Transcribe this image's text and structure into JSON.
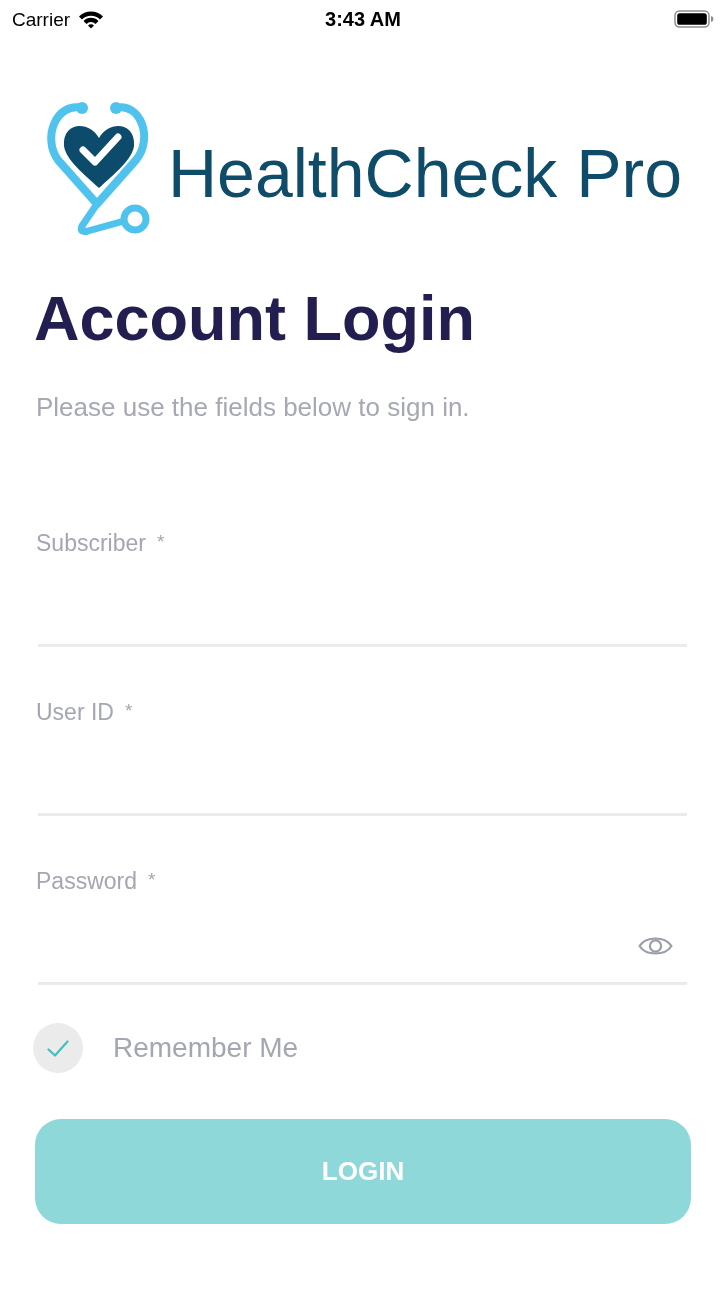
{
  "status_bar": {
    "carrier": "Carrier",
    "time": "3:43 AM"
  },
  "logo": {
    "text": "HealthCheck Pro"
  },
  "title": "Account Login",
  "subtitle": "Please use the fields below to sign in.",
  "fields": [
    {
      "label": "Subscriber",
      "required_mark": "*",
      "kind": "text"
    },
    {
      "label": "User ID",
      "required_mark": "*",
      "kind": "text"
    },
    {
      "label": "Password",
      "required_mark": "*",
      "kind": "password"
    }
  ],
  "remember_me": {
    "label": "Remember Me",
    "checked": true
  },
  "login_button": {
    "label": "LOGIN",
    "disabled": true
  }
}
